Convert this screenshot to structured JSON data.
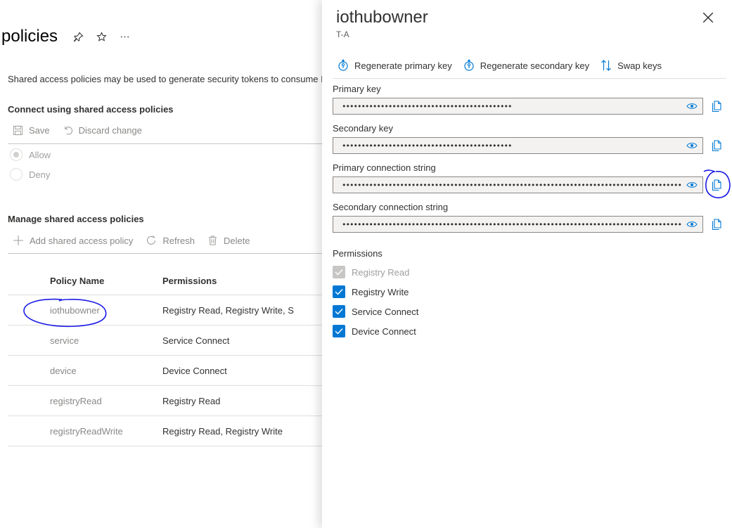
{
  "left": {
    "title": "policies",
    "pin_icon": "pin-icon",
    "star_icon": "star-icon",
    "more_icon": "more-icon",
    "description": "Shared access policies may be used to generate security tokens to consume Io",
    "connect_section": {
      "heading": "Connect using shared access policies",
      "save_label": "Save",
      "discard_label": "Discard change",
      "options": [
        "Allow",
        "Deny"
      ],
      "selected": "Allow"
    },
    "manage_section": {
      "heading": "Manage shared access policies",
      "add_label": "Add shared access policy",
      "refresh_label": "Refresh",
      "delete_label": "Delete"
    },
    "table": {
      "columns": [
        "Policy Name",
        "Permissions"
      ],
      "rows": [
        {
          "name": "iothubowner",
          "permissions": "Registry Read, Registry Write, S"
        },
        {
          "name": "service",
          "permissions": "Service Connect"
        },
        {
          "name": "device",
          "permissions": "Device Connect"
        },
        {
          "name": "registryRead",
          "permissions": "Registry Read"
        },
        {
          "name": "registryReadWrite",
          "permissions": "Registry Read, Registry Write"
        }
      ]
    }
  },
  "panel": {
    "title": "iothubowner",
    "subtitle": "T-A",
    "toolbar": {
      "regen_primary": "Regenerate primary key",
      "regen_secondary": "Regenerate secondary key",
      "swap": "Swap keys"
    },
    "fields": [
      {
        "label": "Primary key",
        "value": "••••••••••••••••••••••••••••••••••••••••••••"
      },
      {
        "label": "Secondary key",
        "value": "••••••••••••••••••••••••••••••••••••••••••••"
      },
      {
        "label": "Primary connection string",
        "value": "••••••••••••••••••••••••••••••••••••••••••••••••••••••••••••••••••••••••••••••••••••••••••••••••…"
      },
      {
        "label": "Secondary connection string",
        "value": "••••••••••••••••••••••••••••••••••••••••••••••••••••••••••••••••••••••••••••••••••••••••••••••••…"
      }
    ],
    "permissions_title": "Permissions",
    "permissions": [
      {
        "label": "Registry Read",
        "checked": true,
        "disabled": true
      },
      {
        "label": "Registry Write",
        "checked": true,
        "disabled": false
      },
      {
        "label": "Service Connect",
        "checked": true,
        "disabled": false
      },
      {
        "label": "Device Connect",
        "checked": true,
        "disabled": false
      }
    ]
  },
  "colors": {
    "accent": "#0078d4",
    "annotation": "#1a1ae6"
  }
}
